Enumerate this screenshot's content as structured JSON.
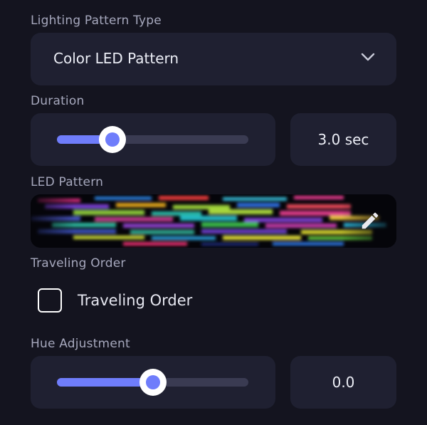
{
  "lighting_pattern_type": {
    "label": "Lighting Pattern Type",
    "selected": "Color LED Pattern",
    "icon": "chevron-down-icon"
  },
  "duration": {
    "label": "Duration",
    "slider_fraction": 0.29,
    "value_text": "3.0 sec"
  },
  "led_pattern": {
    "label": "LED Pattern",
    "edit_icon": "pencil-icon"
  },
  "traveling_order": {
    "label": "Traveling Order",
    "checkbox_label": "Traveling Order",
    "checked": false
  },
  "hue_adjustment": {
    "label": "Hue Adjustment",
    "slider_fraction": 0.5,
    "value_text": "0.0"
  },
  "colors": {
    "background": "#14141f",
    "card": "#1f2031",
    "accent": "#6f7dfb",
    "track": "#3a3b52"
  }
}
